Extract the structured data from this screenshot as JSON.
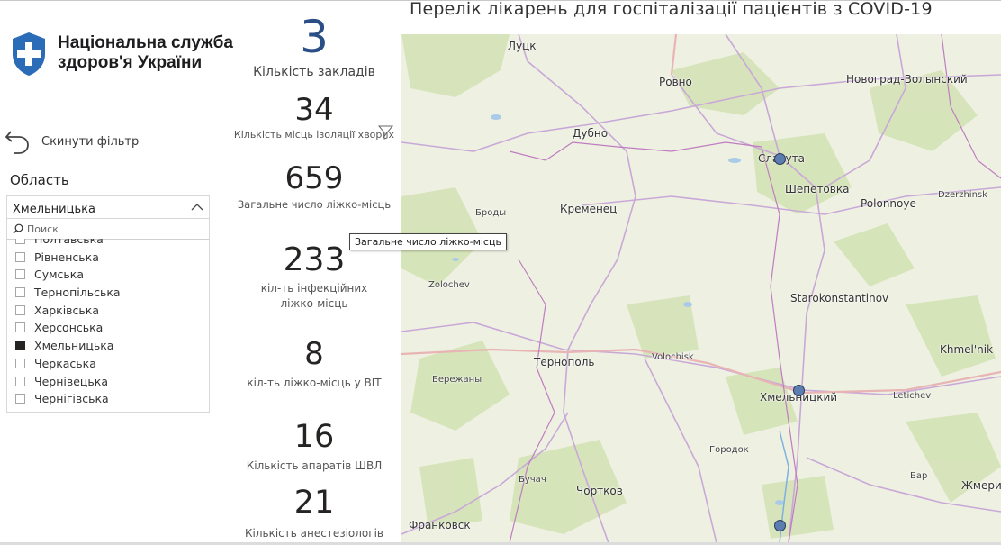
{
  "logo": {
    "line1": "Національна служба",
    "line2": "здоров'я України",
    "brand_color": "#2b6cb8"
  },
  "reset_filter": {
    "label": "Скинути фільтр",
    "icon": "undo-arrow-icon"
  },
  "slicer": {
    "title": "Область",
    "selected": "Хмельницька",
    "search_placeholder": "Поиск",
    "items": [
      {
        "label": "Полтавська",
        "checked": false
      },
      {
        "label": "Рівненська",
        "checked": false
      },
      {
        "label": "Сумська",
        "checked": false
      },
      {
        "label": "Тернопільська",
        "checked": false
      },
      {
        "label": "Харківська",
        "checked": false
      },
      {
        "label": "Херсонська",
        "checked": false
      },
      {
        "label": "Хмельницька",
        "checked": true
      },
      {
        "label": "Черкаська",
        "checked": false
      },
      {
        "label": "Чернівецька",
        "checked": false
      },
      {
        "label": "Чернігівська",
        "checked": false
      }
    ]
  },
  "kpis": [
    {
      "value": "3",
      "label": "Кількість закладів"
    },
    {
      "value": "34",
      "label": "Кількість місць ізоляції хворих"
    },
    {
      "value": "659",
      "label": "Загальне число ліжко-місць"
    },
    {
      "value": "233",
      "label_line1": "кіл-ть інфекційних",
      "label_line2": "ліжко-місць"
    },
    {
      "value": "8",
      "label": "кіл-ть ліжко-місць у ВІТ"
    },
    {
      "value": "16",
      "label": "Кількість апаратів ШВЛ"
    },
    {
      "value": "21",
      "label": "Кількість анестезіологів"
    }
  ],
  "tooltip": "Загальне число ліжко-місць",
  "map": {
    "title": "Перелік лікарень для госпіталізації пацієнтів з COVID-19",
    "marker_color": "#5b7db0",
    "cities": {
      "lutsk": "Луцк",
      "rovno": "Ровно",
      "novograd": "Новоград-Волынский",
      "dubno": "Дубно",
      "slavuta": "Славута",
      "shepetovka": "Шепетовка",
      "polonnoye": "Polonnoye",
      "dzerzhinsk": "Dzerzhinsk",
      "brody": "Броды",
      "kremenets": "Кременец",
      "zolochev": "Zolochev",
      "starokonstantinov": "Starokonstantinov",
      "khmelnik": "Khmel'nik",
      "ternopol": "Тернополь",
      "volochisk": "Volochisk",
      "berezhany": "Бережаны",
      "khmelnitsky": "Хмельницкий",
      "letichev": "Letichev",
      "gorodok": "Городок",
      "buchach": "Бучач",
      "chortkov": "Чортков",
      "bar": "Бар",
      "zhmerinka": "Жмери",
      "frankovsk": "Франковск"
    }
  }
}
